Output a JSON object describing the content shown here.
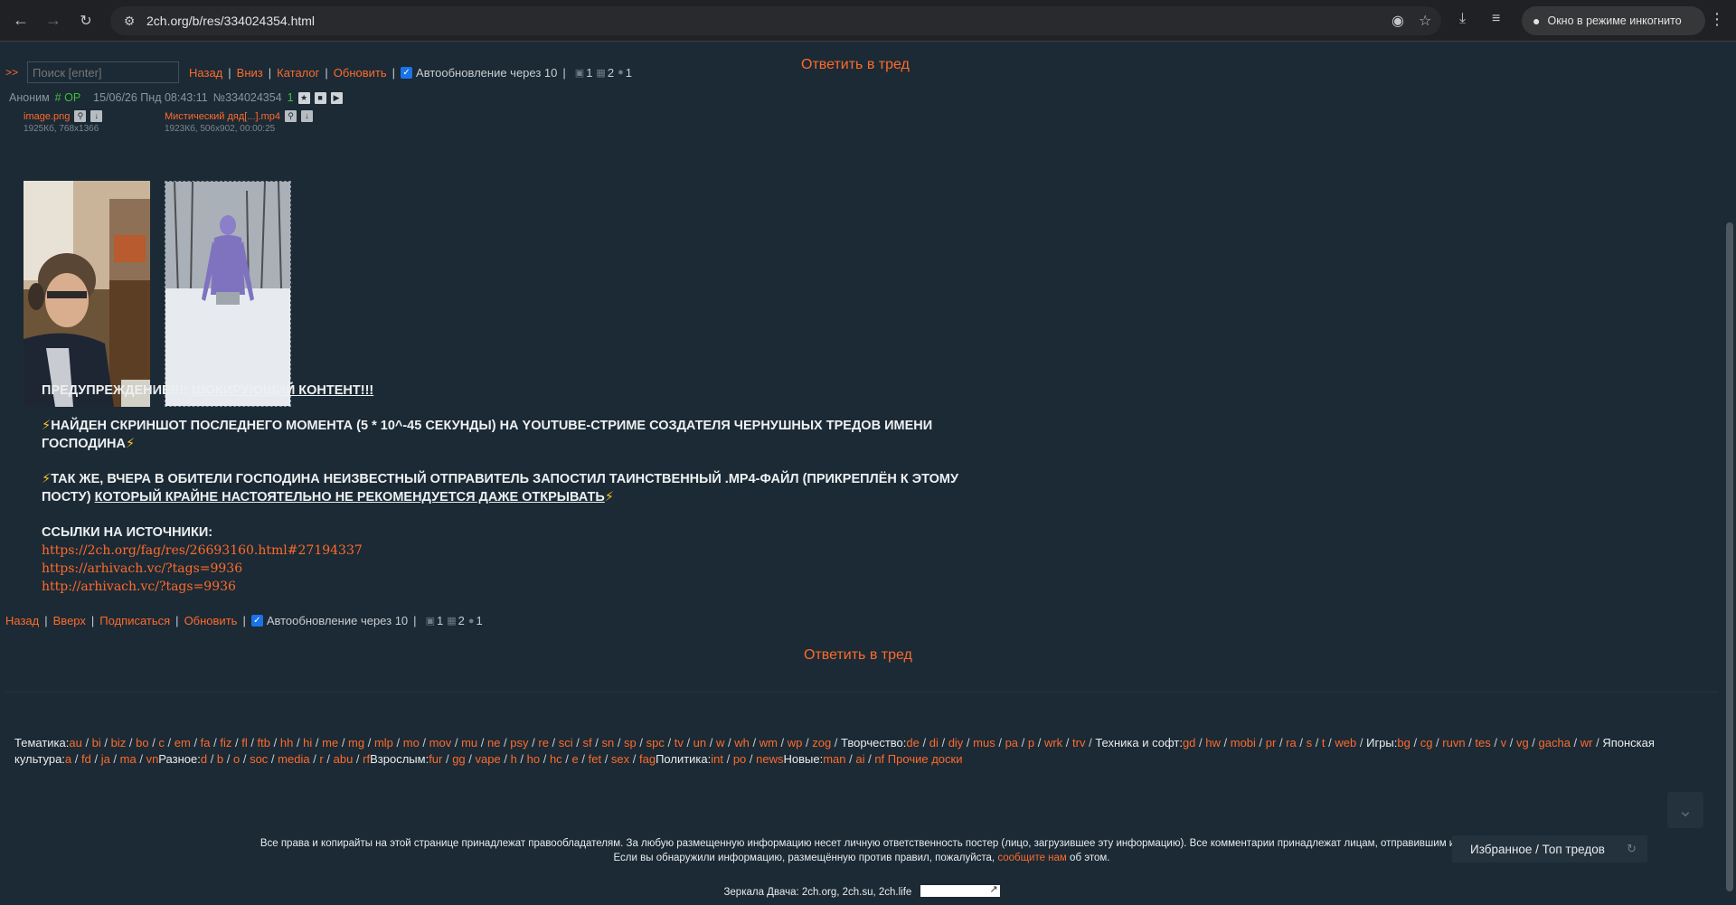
{
  "browser": {
    "url": "2ch.org/b/res/334024354.html",
    "incognito_label": "Окно в режиме инкогнито"
  },
  "reply_top": "Ответить в тред",
  "reply_bottom": "Ответить в тред",
  "topbar": {
    "arrows": ">>",
    "search_placeholder": "Поиск [enter]",
    "links": [
      "Назад",
      "Вниз",
      "Каталог",
      "Обновить"
    ],
    "autoupdate": "Автообновление через 10",
    "stats": {
      "posts": "1",
      "images": "2",
      "posters": "1"
    }
  },
  "post": {
    "author": "Аноним",
    "op": "# OP",
    "date": "15/06/26 Пнд 08:43:11",
    "number": "№334024354",
    "replies_count": "1",
    "files": [
      {
        "name": "image.png",
        "meta": "1925Кб, 768x1366"
      },
      {
        "name": "Мистический дяд[...].mp4",
        "meta": "1923Кб, 506x902, 00:00:25"
      }
    ],
    "body": {
      "warning_label": "ПРЕДУПРЕЖДЕНИЕ!!!:",
      "warning_link": "ШОКИРУЮЩИЙ КОНТЕНТ!!!",
      "para1": "НАЙДЕН СКРИНШОТ ПОСЛЕДНЕГО МОМЕНТА (5 * 10^-45 СЕКУНДЫ) НА YOUTUBE-СТРИМЕ СОЗДАТЕЛЯ ЧЕРНУШНЫХ ТРЕДОВ ИМЕНИ ГОСПОДИНА",
      "para2_plain": "ТАК ЖЕ, ВЧЕРА В ОБИТЕЛИ ГОСПОДИНА НЕИЗВЕСТНЫЙ ОТПРАВИТЕЛЬ ЗАПОСТИЛ ТАИНСТВЕННЫЙ .MP4-ФАЙЛ (ПРИКРЕПЛЁН К ЭТОМУ ПОСТУ)",
      "para2_underlined": "КОТОРЫЙ КРАЙНЕ НАСТОЯТЕЛЬНО НЕ РЕКОМЕНДУЕТСЯ ДАЖЕ ОТКРЫВАТЬ",
      "sources_label": "ССЫЛКИ НА ИСТОЧНИКИ:",
      "sources": [
        "https://2ch.org/fag/res/26693160.html#27194337",
        "https://arhivach.vc/?tags=9936",
        "http://arhivach.vc/?tags=9936"
      ]
    }
  },
  "bottombar": {
    "links": [
      "Назад",
      "Вверх",
      "Подписаться",
      "Обновить"
    ],
    "autoupdate": "Автообновление через 10",
    "stats": {
      "posts": "1",
      "images": "2",
      "posters": "1"
    }
  },
  "boards": {
    "line1": [
      {
        "cat": "Тематика:",
        "items": [
          "au",
          "bi",
          "biz",
          "bo",
          "c",
          "em",
          "fa",
          "fiz",
          "fl",
          "ftb",
          "hh",
          "hi",
          "me",
          "mg",
          "mlp",
          "mo",
          "mov",
          "mu",
          "ne",
          "psy",
          "re",
          "sci",
          "sf",
          "sn",
          "sp",
          "spc",
          "tv",
          "un",
          "w",
          "wh",
          "wm",
          "wp",
          "zog"
        ]
      },
      {
        "cat": "Творчество:",
        "items": [
          "de",
          "di",
          "diy",
          "mus",
          "pa",
          "p",
          "wrk",
          "trv"
        ]
      },
      {
        "cat": "Техника и софт:",
        "items": [
          "gd",
          "hw",
          "mobi",
          "pr",
          "ra",
          "s",
          "t",
          "web"
        ]
      },
      {
        "cat": "Игры:",
        "items": [
          "bg",
          "cg",
          "ruvn"
        ]
      }
    ],
    "line2_lead": [
      "tes",
      "v",
      "vg",
      "gacha",
      "wr"
    ],
    "line2": [
      {
        "cat": "Японская культура:",
        "items": [
          "a",
          "fd",
          "ja",
          "ma",
          "vn"
        ]
      },
      {
        "cat": "Разное:",
        "items": [
          "d",
          "b",
          "o",
          "soc",
          "media",
          "r",
          "abu",
          "rf"
        ]
      },
      {
        "cat": "Взрослым:",
        "items": [
          "fur",
          "gg",
          "vape",
          "h",
          "ho",
          "hc",
          "e",
          "fet",
          "sex",
          "fag"
        ]
      },
      {
        "cat": "Политика:",
        "items": [
          "int",
          "po",
          "news"
        ]
      },
      {
        "cat": "Новые:",
        "items": [
          "man",
          "ai",
          "nf"
        ]
      }
    ],
    "other_boards": "Прочие доски"
  },
  "footer": {
    "line1": "Все права и копирайты на этой странице принадлежат правообладателям. За любую размещенную информацию несет личную ответственность постер (лицо, загрузившее эту информацию). Все комментарии принадлежат лицам, отправившим их.",
    "line2_pre": "Если вы обнаружили информацию, размещённую против правил, пожалуйста,",
    "line2_link": "сообщите нам",
    "line2_post": "об этом.",
    "mirrors": "Зеркала Двача: 2ch.org, 2ch.su, 2ch.life"
  },
  "favorites_label": "Избранное / Топ тредов"
}
